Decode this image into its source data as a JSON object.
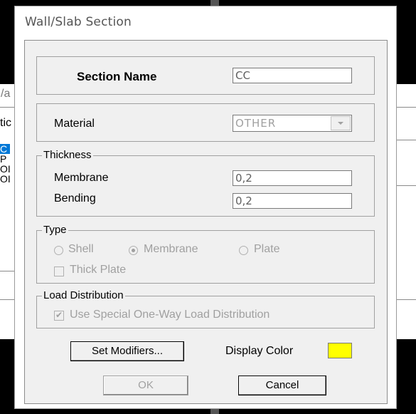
{
  "background": {
    "left_fragments": [
      "/a",
      "tic",
      "C",
      "P",
      "OI",
      "OI"
    ]
  },
  "dialog": {
    "title": "Wall/Slab Section",
    "section_name": {
      "label": "Section Name",
      "value": "CC"
    },
    "material": {
      "label": "Material",
      "value": "OTHER"
    },
    "thickness": {
      "caption": "Thickness",
      "membrane": {
        "label": "Membrane",
        "value": "0,2"
      },
      "bending": {
        "label": "Bending",
        "value": "0,2"
      }
    },
    "type": {
      "caption": "Type",
      "options": [
        "Shell",
        "Membrane",
        "Plate"
      ],
      "selected": "Membrane",
      "thick_plate": "Thick Plate"
    },
    "load_distribution": {
      "caption": "Load Distribution",
      "checkbox": "Use Special One-Way Load Distribution",
      "checked": true
    },
    "set_modifiers": "Set Modifiers...",
    "display_color": {
      "label": "Display Color",
      "color": "#ffff00"
    },
    "ok": "OK",
    "cancel": "Cancel"
  }
}
